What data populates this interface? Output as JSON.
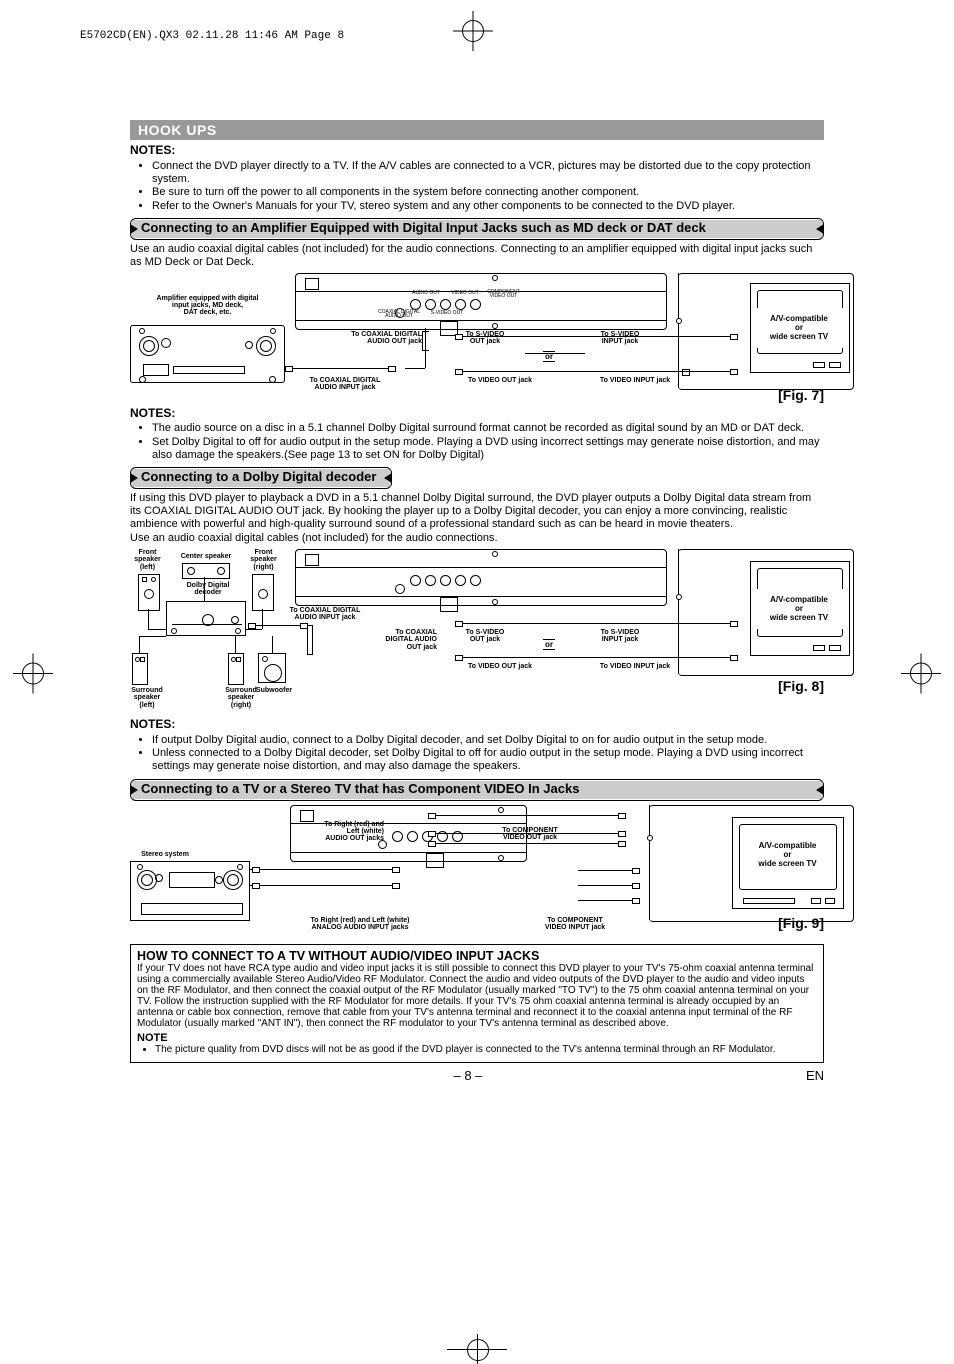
{
  "print_header": "E5702CD(EN).QX3  02.11.28 11:46 AM  Page 8",
  "section_bar": "HOOK UPS",
  "notes_label": "NOTES:",
  "intro_notes": [
    "Connect the DVD player directly to a TV. If the A/V cables are connected to a VCR, pictures may be distorted due to the copy protection system.",
    "Be sure to turn off the power to all components in the system before connecting another component.",
    "Refer to the Owner's Manuals for your TV, stereo system and any other components to be connected to the DVD player."
  ],
  "sub1": "Connecting to an Amplifier Equipped with Digital Input Jacks such as MD deck or DAT deck",
  "sub1_text": "Use an audio coaxial digital cables (not included) for the audio connections. Connecting to an amplifier equipped with digital input jacks such as MD Deck or Dat Deck.",
  "fig7": {
    "amp_label": "Amplifier equipped with digital\ninput jacks, MD deck,\nDAT deck, etc.",
    "to_coax_in": "To COAXIAL DIGITAL\nAUDIO INPUT jack",
    "to_coax_out": "To COAXIAL DIGITAL\nAUDIO OUT jack",
    "to_svideo_out": "To S-VIDEO\nOUT jack",
    "to_svideo_in": "To S-VIDEO\nINPUT jack",
    "to_video_out": "To VIDEO OUT jack",
    "to_video_in": "To VIDEO INPUT jack",
    "or": "or",
    "tv": "A/V-compatible\nor\nwide screen TV",
    "caption": "[Fig. 7]",
    "back_labels": {
      "audio_out": "AUDIO OUT",
      "video_out": "VIDEO OUT",
      "component": "COMPONENT\nVIDEO OUT",
      "coaxial": "COAXIAL\nDIGITAL AUDIO OUT",
      "svideo": "S-VIDEO OUT"
    }
  },
  "notes1": [
    "The audio source on a disc in a 5.1 channel Dolby Digital surround format cannot be recorded as digital sound by an MD or DAT deck.",
    "Set Dolby Digital to off for audio output in the setup mode. Playing a DVD using incorrect settings may generate noise distortion, and may also damage the speakers.(See page 13 to set ON for Dolby Digital)"
  ],
  "sub2": "Connecting to a Dolby Digital decoder",
  "sub2_text1": "If using this DVD player to playback a DVD in a 5.1 channel Dolby Digital surround, the DVD player outputs a Dolby Digital data stream from its COAXIAL DIGITAL AUDIO OUT jack. By hooking the player up to a Dolby Digital decoder, you can enjoy a more convincing, realistic ambience with powerful and high-quality surround sound of a professional standard such as can be heard in movie theaters.",
  "sub2_text2": "Use an audio coaxial digital cables (not included) for the audio connections.",
  "fig8": {
    "front_left": "Front\nspeaker\n(left)",
    "center": "Center speaker",
    "front_right": "Front\nspeaker\n(right)",
    "decoder": "Dolby Digital\ndecoder",
    "surround_left": "Surround\nspeaker\n(left)",
    "surround_right": "Surround\nspeaker\n(right)",
    "subwoofer": "Subwoofer",
    "to_coax_in": "To COAXIAL DIGITAL\nAUDIO INPUT jack",
    "to_coax_out": "To COAXIAL\nDIGITAL AUDIO\nOUT jack",
    "to_svideo_out": "To S-VIDEO\nOUT jack",
    "to_svideo_in": "To S-VIDEO\nINPUT jack",
    "to_video_out": "To VIDEO OUT jack",
    "to_video_in": "To VIDEO INPUT jack",
    "or": "or",
    "tv": "A/V-compatible\nor\nwide screen TV",
    "caption": "[Fig. 8]"
  },
  "notes2": [
    "If output Dolby Digital audio, connect to a Dolby Digital decoder, and set Dolby Digital to on for audio output in the setup mode.",
    "Unless connected to a Dolby Digital decoder, set Dolby Digital to off for audio output in the setup mode. Playing a DVD using incorrect settings may generate noise distortion, and may also damage the speakers."
  ],
  "sub3": "Connecting to a TV or a Stereo TV that has Component VIDEO In Jacks",
  "fig9": {
    "stereo_system": "Stereo system",
    "to_rl_out": "To Right (red) and\nLeft (white)\nAUDIO OUT jacks",
    "to_rl_in": "To Right (red) and Left (white)\nANALOG AUDIO INPUT jacks",
    "to_comp_out": "To COMPONENT\nVIDEO OUT jack",
    "to_comp_in": "To COMPONENT\nVIDEO INPUT jack",
    "tv": "A/V-compatible\nor\nwide screen TV",
    "caption": "[Fig. 9]"
  },
  "howto_title": "HOW TO CONNECT TO A TV WITHOUT AUDIO/VIDEO INPUT JACKS",
  "howto_text": "If your TV does not have RCA type audio and video input jacks it is still possible to connect this DVD player to your TV's 75-ohm coaxial antenna terminal using a commercially available Stereo Audio/Video RF Modulator. Connect the audio and video outputs of the DVD player to the audio and video inputs on the RF Modulator, and then connect the coaxial output of the RF Modulator (usually marked \"TO TV\") to the 75 ohm coaxial antenna terminal on your TV. Follow the instruction supplied with the RF Modulator for more details. If your TV's 75 ohm coaxial antenna terminal is already occupied by an antenna or cable box connection, remove that cable from your TV's antenna terminal and reconnect it to the coaxial antenna input terminal of the RF Modulator (usually marked \"ANT IN\"), then connect the RF modulator to your TV's antenna terminal as described above.",
  "note_label": "NOTE",
  "howto_note": "The picture quality from DVD discs will not be as good if the DVD player is connected to the TV's antenna terminal through an RF Modulator.",
  "page_num": "– 8 –",
  "en": "EN"
}
